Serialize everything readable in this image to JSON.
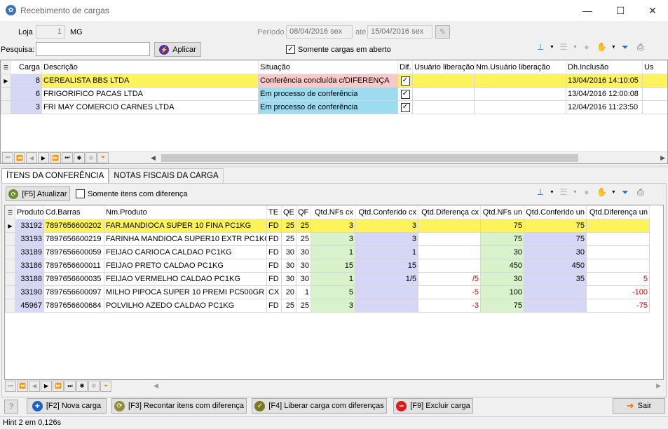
{
  "window": {
    "title": "Recebimento de cargas",
    "minimize": "—",
    "maximize": "☐",
    "close": "✕"
  },
  "filters": {
    "loja_label": "Loja",
    "loja_value": "1",
    "uf": "MG",
    "periodo_label": "Período",
    "periodo_from": "08/04/2016 sex",
    "ate_label": "até",
    "periodo_to": "15/04/2016 sex",
    "pesquisa_label": "Pesquisa:",
    "pesquisa_value": "",
    "aplicar_label": "Aplicar",
    "somente_abertas_label": "Somente cargas em aberto",
    "somente_abertas_checked": true
  },
  "cargas": {
    "columns": [
      "Carga",
      "Descrição",
      "Situação",
      "Dif.",
      "Usuário liberação",
      "Nm.Usuário liberação",
      "Dh.Inclusão",
      "Us"
    ],
    "rows": [
      {
        "carga": "8",
        "descricao": "CEREALISTA BBS LTDA",
        "situacao": "Conferência concluída c/DIFERENÇA",
        "dif": true,
        "usuario": "",
        "nm_usuario": "",
        "dh": "13/04/2016 14:10:05",
        "selected": true
      },
      {
        "carga": "6",
        "descricao": "FRIGORIFICO PACAS LTDA",
        "situacao": "Em processo de conferência",
        "dif": true,
        "usuario": "",
        "nm_usuario": "",
        "dh": "13/04/2016 12:00:08",
        "selected": false
      },
      {
        "carga": "3",
        "descricao": "FRI MAY COMERCIO CARNES LTDA",
        "situacao": "Em processo de conferência",
        "dif": true,
        "usuario": "",
        "nm_usuario": "",
        "dh": "12/04/2016 11:23:50",
        "selected": false
      }
    ]
  },
  "tabs": [
    "ÍTENS DA CONFERÊNCIA",
    "NOTAS FISCAIS DA CARGA"
  ],
  "itens_toolbar": {
    "atualizar_label": "[F5] Atualizar",
    "somente_dif_label": "Somente itens com diferença"
  },
  "itens": {
    "columns": [
      "Produto",
      "Cd.Barras",
      "Nm.Produto",
      "TE",
      "QE",
      "QF",
      "Qtd.NFs cx",
      "Qtd.Conferido cx",
      "Qtd.Diferença cx",
      "Qtd.NFs un",
      "Qtd.Conferido un",
      "Qtd.Diferença un"
    ],
    "rows": [
      {
        "produto": "33192",
        "barras": "7897656600202",
        "nome": "FAR.MANDIOCA SUPER 10 FINA PC1KG",
        "te": "FD",
        "qe": "25",
        "qf": "25",
        "nfs_cx": "3",
        "conf_cx": "3",
        "dif_cx": "",
        "nfs_un": "75",
        "conf_un": "75",
        "dif_un": "",
        "selected": true
      },
      {
        "produto": "33193",
        "barras": "7897656600219",
        "nome": "FARINHA MANDIOCA SUPER10 EXTR PC1KG",
        "te": "FD",
        "qe": "25",
        "qf": "25",
        "nfs_cx": "3",
        "conf_cx": "3",
        "dif_cx": "",
        "nfs_un": "75",
        "conf_un": "75",
        "dif_un": "",
        "selected": false
      },
      {
        "produto": "33189",
        "barras": "7897656600059",
        "nome": "FEIJAO CARIOCA CALDAO PC1KG",
        "te": "FD",
        "qe": "30",
        "qf": "30",
        "nfs_cx": "1",
        "conf_cx": "1",
        "dif_cx": "",
        "nfs_un": "30",
        "conf_un": "30",
        "dif_un": "",
        "selected": false
      },
      {
        "produto": "33186",
        "barras": "7897656600011",
        "nome": "FEIJAO PRETO CALDAO PC1KG",
        "te": "FD",
        "qe": "30",
        "qf": "30",
        "nfs_cx": "15",
        "conf_cx": "15",
        "dif_cx": "",
        "nfs_un": "450",
        "conf_un": "450",
        "dif_un": "",
        "selected": false
      },
      {
        "produto": "33188",
        "barras": "7897656600035",
        "nome": "FEIJAO VERMELHO CALDAO PC1KG",
        "te": "FD",
        "qe": "30",
        "qf": "30",
        "nfs_cx": "1",
        "conf_cx": "1/5",
        "dif_cx": "/5",
        "nfs_un": "30",
        "conf_un": "35",
        "dif_un": "5",
        "selected": false
      },
      {
        "produto": "33190",
        "barras": "7897656600097",
        "nome": "MILHO PIPOCA SUPER 10 PREMI PC500GR",
        "te": "CX",
        "qe": "20",
        "qf": "1",
        "nfs_cx": "5",
        "conf_cx": "",
        "dif_cx": "-5",
        "nfs_un": "100",
        "conf_un": "",
        "dif_un": "-100",
        "selected": false
      },
      {
        "produto": "45967",
        "barras": "7897656600684",
        "nome": "POLVILHO AZEDO CALDAO PC1KG",
        "te": "FD",
        "qe": "25",
        "qf": "25",
        "nfs_cx": "3",
        "conf_cx": "",
        "dif_cx": "-3",
        "nfs_un": "75",
        "conf_un": "",
        "dif_un": "-75",
        "selected": false
      }
    ]
  },
  "footer": {
    "nova_carga": "[F2] Nova carga",
    "recontar": "[F3] Recontar itens com diferença",
    "liberar": "[F4] Liberar carga com diferenças",
    "excluir": "[F9] Excluir carga",
    "sair": "Sair"
  },
  "status": {
    "hint": "Hint 2 em 0,126s"
  },
  "colors": {
    "selected_row": "#fff35c",
    "diff_situation": "#f9c8c8",
    "in_progress": "#9ddcf0",
    "lavender": "#d6d6f7",
    "green": "#d8f2cc",
    "negative": "#d00000"
  }
}
